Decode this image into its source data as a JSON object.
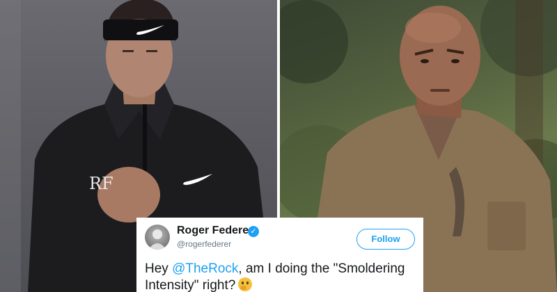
{
  "images": {
    "left": {
      "icon": "portrait-studio"
    },
    "right": {
      "icon": "portrait-jungle"
    }
  },
  "tweet": {
    "author_name": "Roger Federer",
    "verified_icon": "verified-badge-icon",
    "handle": "@rogerfederer",
    "follow_label": "Follow",
    "text_prefix": "Hey ",
    "mention": "@TheRock",
    "text_suffix": ", am I doing the \"Smoldering Intensity\" right?",
    "emoji_icon": "thinking-face-icon"
  },
  "colors": {
    "twitter_blue": "#1da1f2",
    "text_dark": "#14171a",
    "text_muted": "#657786"
  }
}
